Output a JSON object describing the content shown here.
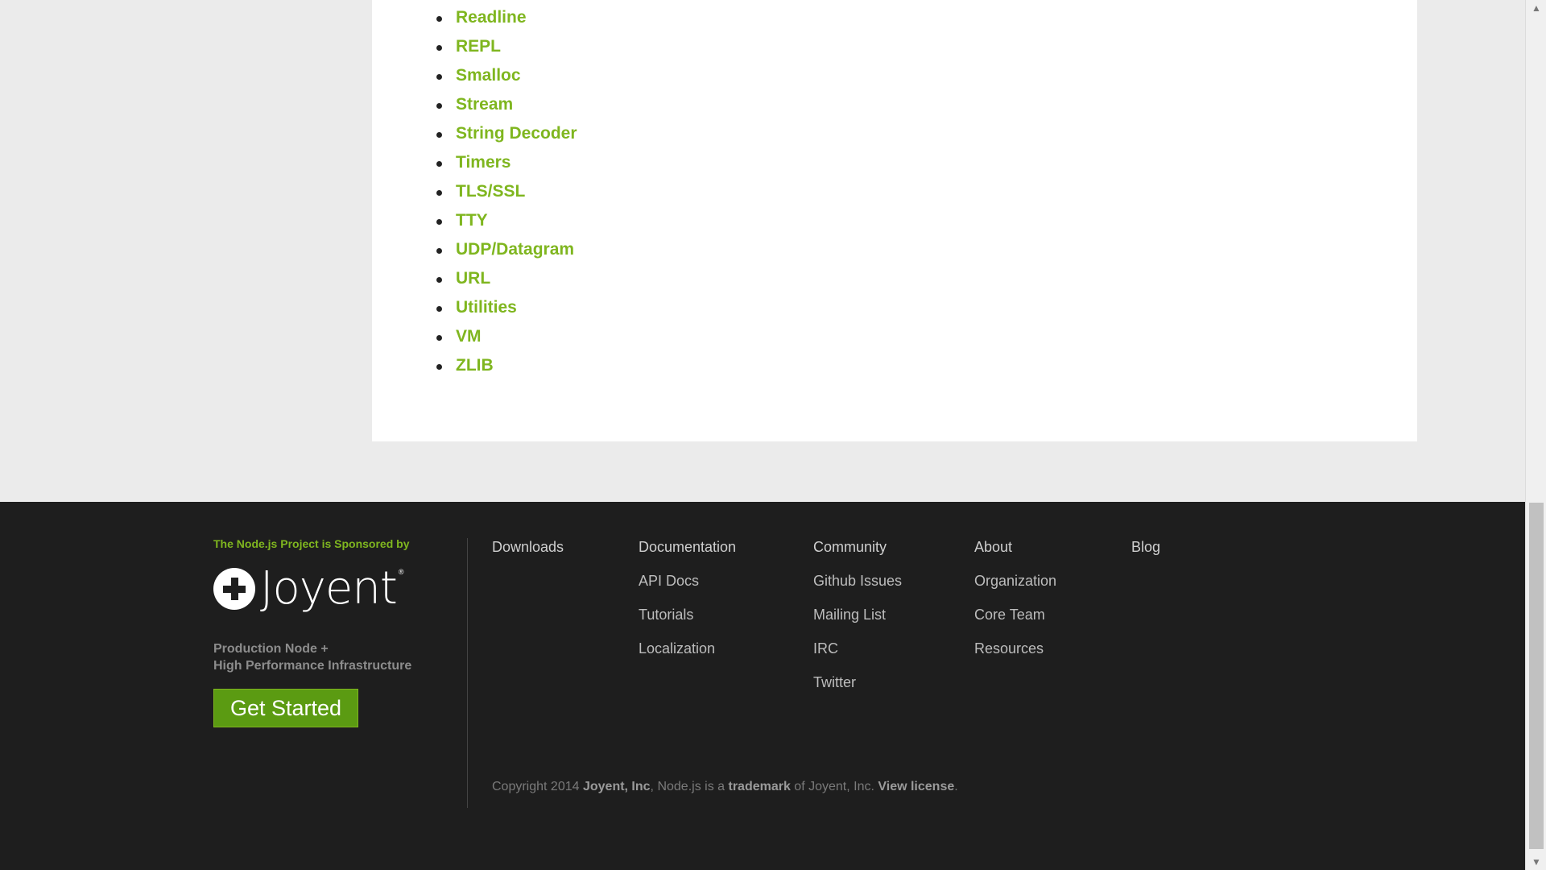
{
  "api_list": [
    {
      "label": "Readline"
    },
    {
      "label": "REPL"
    },
    {
      "label": "Smalloc"
    },
    {
      "label": "Stream"
    },
    {
      "label": "String Decoder"
    },
    {
      "label": "Timers"
    },
    {
      "label": "TLS/SSL"
    },
    {
      "label": "TTY"
    },
    {
      "label": "UDP/Datagram"
    },
    {
      "label": "URL"
    },
    {
      "label": "Utilities"
    },
    {
      "label": "VM"
    },
    {
      "label": "ZLIB"
    }
  ],
  "footer": {
    "sponsor_text": "The Node.js Project is Sponsored by",
    "logo_text": "Joyent",
    "logo_reg": "®",
    "tagline_line1": "Production Node +",
    "tagline_line2": "High Performance Infrastructure",
    "get_started_label": "Get Started",
    "columns": {
      "downloads": {
        "head": "Downloads",
        "items": []
      },
      "documentation": {
        "head": "Documentation",
        "items": [
          "API Docs",
          "Tutorials",
          "Localization"
        ]
      },
      "community": {
        "head": "Community",
        "items": [
          "Github Issues",
          "Mailing List",
          "IRC",
          "Twitter"
        ]
      },
      "about": {
        "head": "About",
        "items": [
          "Organization",
          "Core Team",
          "Resources"
        ]
      },
      "blog": {
        "head": "Blog",
        "items": []
      }
    },
    "copyright": {
      "prefix": "Copyright 2014 ",
      "company": "Joyent, Inc",
      "middle": ", Node.js is a ",
      "trademark": "trademark",
      "suffix": " of Joyent, Inc. ",
      "license": "View license",
      "end": "."
    }
  },
  "scrollbar": {
    "up_arrow": "▲",
    "down_arrow": "▼"
  },
  "colors": {
    "link_green": "#7fb61f",
    "button_green": "#5b9b12",
    "footer_bg": "#1e1e1e",
    "page_bg": "#ebebeb"
  }
}
